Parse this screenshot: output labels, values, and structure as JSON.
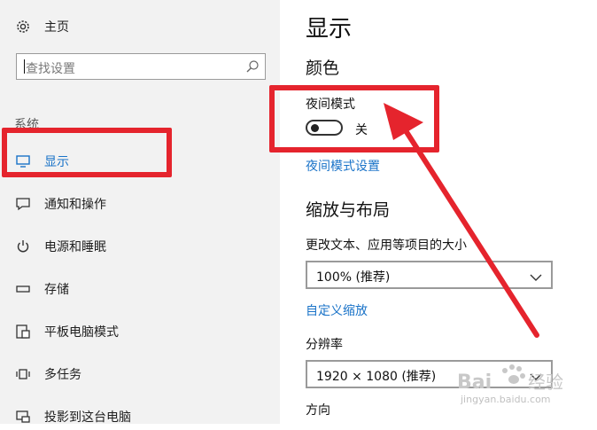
{
  "sidebar": {
    "home_label": "主页",
    "search_placeholder": "查找设置",
    "section_label": "系统",
    "items": [
      {
        "label": "显示"
      },
      {
        "label": "通知和操作"
      },
      {
        "label": "电源和睡眠"
      },
      {
        "label": "存储"
      },
      {
        "label": "平板电脑模式"
      },
      {
        "label": "多任务"
      },
      {
        "label": "投影到这台电脑"
      }
    ]
  },
  "main": {
    "title": "显示",
    "color_heading": "颜色",
    "night_mode_label": "夜间模式",
    "night_mode_state": "关",
    "night_mode_settings_link": "夜间模式设置",
    "scale_heading": "缩放与布局",
    "scale_label": "更改文本、应用等项目的大小",
    "scale_value": "100% (推荐)",
    "custom_scale_link": "自定义缩放",
    "resolution_label": "分辨率",
    "resolution_value": "1920 × 1080 (推荐)",
    "orientation_label": "方向"
  },
  "watermark": {
    "brand": "Baidu 经验",
    "url": "jingyan.baidu.com"
  },
  "colors": {
    "accent": "#1a73c8",
    "annotation_red": "#e5242d",
    "sidebar_bg": "#f2f2f2"
  }
}
